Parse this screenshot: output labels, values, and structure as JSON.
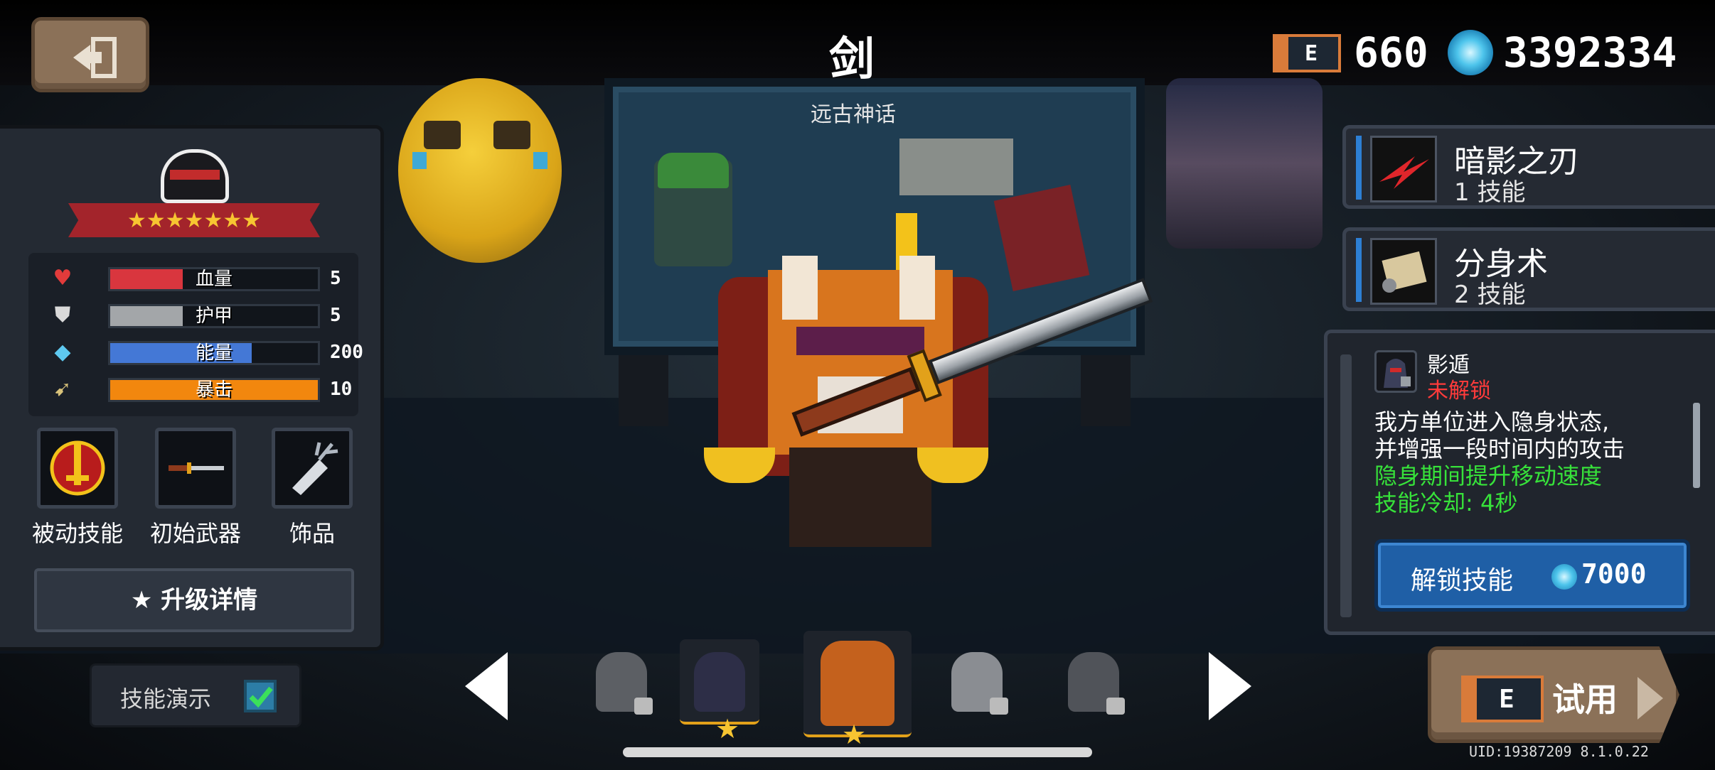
{
  "header": {
    "hero_name": "剑",
    "hero_tag": "远古神话",
    "ecard_badge": "E",
    "ecard_count": "660",
    "gem_count": "3392334"
  },
  "stats": {
    "stars": "★★★★★★★",
    "rows": [
      {
        "label": "血量",
        "value": "5",
        "fill": 0.35,
        "color": "#d9363e"
      },
      {
        "label": "护甲",
        "value": "5",
        "fill": 0.35,
        "color": "#a3a6a9"
      },
      {
        "label": "能量",
        "value": "200",
        "fill": 0.68,
        "color": "#4478d6"
      },
      {
        "label": "暴击",
        "value": "10",
        "fill": 1.0,
        "color": "#f2870e"
      }
    ],
    "slots": [
      "被动技能",
      "初始武器",
      "饰品"
    ],
    "upgrade_button": "★ 升级详情"
  },
  "demo": {
    "label": "技能演示",
    "checked": true
  },
  "skills": [
    {
      "name": "暗影之刃",
      "sub": "1 技能"
    },
    {
      "name": "分身术",
      "sub": "2 技能"
    }
  ],
  "detail": {
    "title": "影遁",
    "status": "未解锁",
    "lines": [
      {
        "text": "我方单位进入隐身状态,",
        "color": "#ffffff"
      },
      {
        "text": "并增强一段时间内的攻击",
        "color": "#ffffff"
      },
      {
        "text": "隐身期间提升移动速度",
        "color": "#37e23a"
      },
      {
        "text": "技能冷却: 4秒",
        "color": "#37e23a"
      }
    ],
    "unlock_label": "解锁技能",
    "unlock_cost": "7000"
  },
  "trial": {
    "badge": "E",
    "label": "试用"
  },
  "uid": "UID:19387209 8.1.0.22",
  "colors": {
    "accent_blue": "#2d7fd4",
    "brown_button": "#8b7158",
    "status_red": "#ff3b3b",
    "green_text": "#37e23a"
  }
}
